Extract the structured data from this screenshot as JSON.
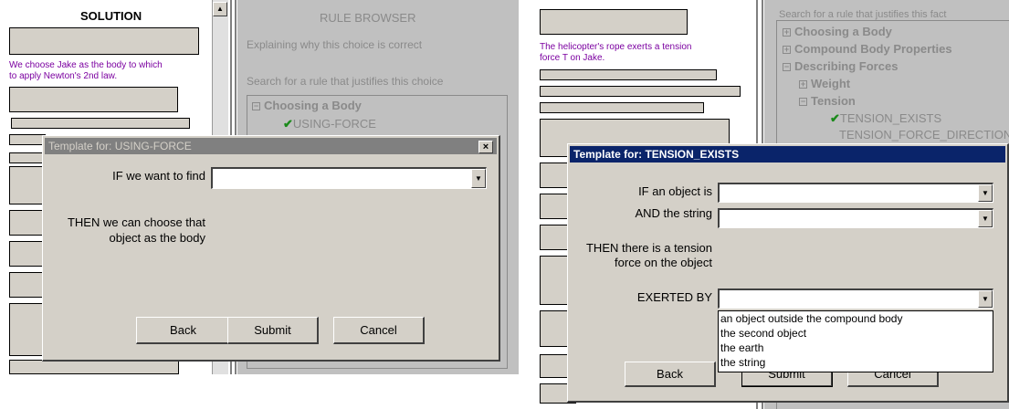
{
  "left": {
    "solution_header": "SOLUTION",
    "rule_browser_title": "RULE BROWSER",
    "explaining_text": "Explaining why this choice is correct",
    "search_text": "Search for a rule that justifies this choice",
    "statement": "We choose Jake as the body to which to apply Newton's 2nd law.",
    "tree": {
      "root": "Choosing a Body",
      "child": "USING-FORCE"
    },
    "dialog": {
      "title": "Template for: USING-FORCE",
      "close": "×",
      "if_label": "IF we want to find",
      "if_value": "",
      "then_text": "THEN we can choose that object as the body",
      "back": "Back",
      "submit": "Submit",
      "cancel": "Cancel"
    }
  },
  "right": {
    "search_text": "Search for a rule that justifies this fact",
    "statement": "The helicopter's rope exerts a  tension force T on Jake.",
    "tree": {
      "items": [
        "Choosing a Body",
        "Compound Body Properties",
        "Describing Forces",
        "Weight",
        "Tension",
        "TENSION_EXISTS",
        "TENSION_FORCE_DIRECTION"
      ]
    },
    "dialog": {
      "title": "Template for: TENSION_EXISTS",
      "if_label": "IF an object is",
      "and_label": "AND the string",
      "then_text": "THEN there is a tension force on the object",
      "exerted_label": "EXERTED BY",
      "options": [
        "an object outside the compound body",
        "the second object",
        "the earth",
        "the string"
      ],
      "back": "Back",
      "submit": "Submit",
      "cancel": "Cancel"
    }
  }
}
